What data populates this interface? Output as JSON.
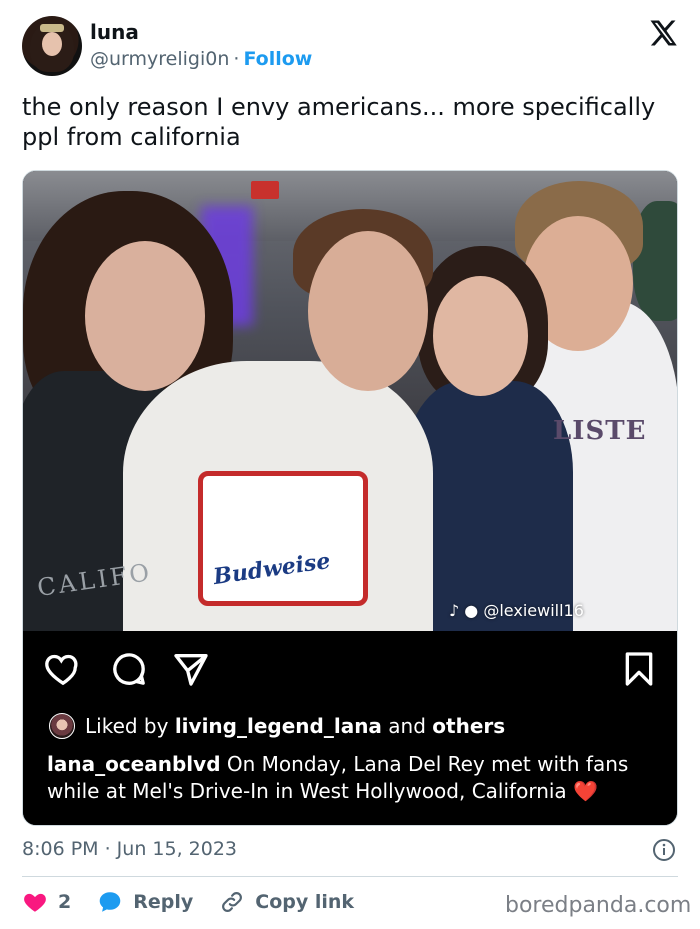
{
  "tweet": {
    "author": {
      "display_name": "luna",
      "handle": "@urmyreligi0n",
      "separator": "·",
      "follow_label": "Follow"
    },
    "text": "the only reason I envy americans... more specifically ppl from california",
    "timestamp": "8:06 PM · Jun 15, 2023",
    "likes": "2",
    "reply_label": "Reply",
    "copy_link_label": "Copy link"
  },
  "media": {
    "photo_watermark": "@lexiewill16",
    "shirt_text_left": "CALIFO",
    "shirt_text_middle": "Budweise",
    "shirt_text_right": "LISTE"
  },
  "instagram": {
    "liked_prefix": "Liked by",
    "liked_user": "living_legend_lana",
    "liked_and": "and",
    "liked_others": "others",
    "caption_user": "lana_oceanblvd",
    "caption_text": "On Monday, Lana Del Rey met with fans while at Mel's Drive-In in West Hollywood, California",
    "caption_emoji": "❤️"
  },
  "branding": {
    "site": "boredpanda.com"
  },
  "colors": {
    "accent": "#1d9bf0",
    "like": "#f91880",
    "text_secondary": "#536471"
  },
  "icons": [
    "x-logo-icon",
    "heart-icon",
    "comment-icon",
    "share-icon",
    "bookmark-icon",
    "info-icon",
    "reply-bubble-icon",
    "link-icon"
  ]
}
